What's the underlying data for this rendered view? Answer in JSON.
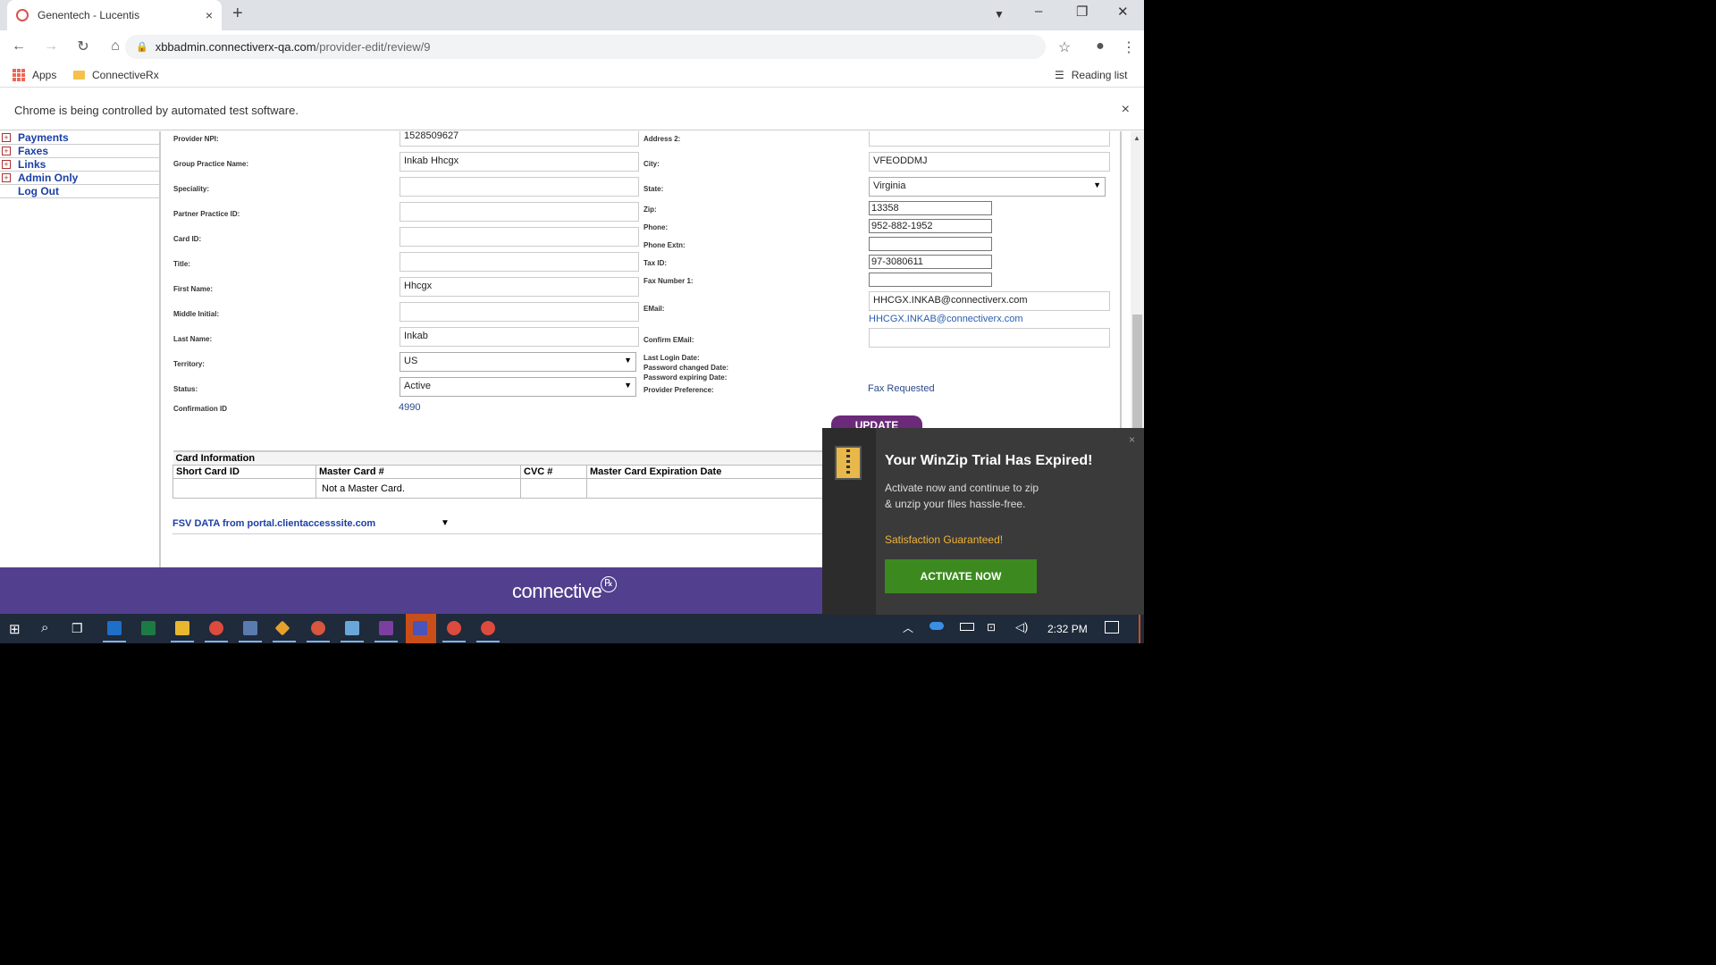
{
  "browser": {
    "tab_title": "Genentech - Lucentis",
    "tab_close": "×",
    "new_tab": "+",
    "url_host": "xbbadmin.connectiverx-qa.com",
    "url_path": "/provider-edit/review/9",
    "bookmarks": [
      {
        "label": "Apps"
      },
      {
        "label": "ConnectiveRx"
      }
    ],
    "reading_list": "Reading list",
    "infobar_text": "Chrome is being controlled by automated test software.",
    "infobar_close": "×"
  },
  "sidebar": {
    "items": [
      {
        "label": "Payments"
      },
      {
        "label": "Faxes"
      },
      {
        "label": "Links"
      },
      {
        "label": "Admin Only"
      }
    ],
    "logout": "Log Out"
  },
  "form": {
    "left": {
      "provider_npi": {
        "label": "Provider NPI:",
        "value": "1528509627"
      },
      "group_practice": {
        "label": "Group Practice Name:",
        "value": "Inkab Hhcgx"
      },
      "speciality": {
        "label": "Speciality:",
        "value": ""
      },
      "partner_practice": {
        "label": "Partner Practice ID:",
        "value": ""
      },
      "card_id": {
        "label": "Card ID:",
        "value": ""
      },
      "title": {
        "label": "Title:",
        "value": ""
      },
      "first_name": {
        "label": "First Name:",
        "value": "Hhcgx"
      },
      "middle_initial": {
        "label": "Middle Initial:",
        "value": ""
      },
      "last_name": {
        "label": "Last Name:",
        "value": "Inkab"
      },
      "territory": {
        "label": "Territory:",
        "value": "US"
      },
      "status": {
        "label": "Status:",
        "value": "Active"
      },
      "confirmation": {
        "label": "Confirmation ID",
        "value": "4990"
      }
    },
    "right": {
      "address2": {
        "label": "Address 2:",
        "value": ""
      },
      "city": {
        "label": "City:",
        "value": "VFEODDMJ"
      },
      "state": {
        "label": "State:",
        "value": "Virginia"
      },
      "zip": {
        "label": "Zip:",
        "value": "13358"
      },
      "phone": {
        "label": "Phone:",
        "value": "952-882-1952"
      },
      "phone_extn": {
        "label": "Phone Extn:",
        "value": ""
      },
      "tax_id": {
        "label": "Tax ID:",
        "value": "97-3080611"
      },
      "fax1": {
        "label": "Fax Number 1:",
        "value": ""
      },
      "email": {
        "label": "EMail:",
        "value": "HHCGX.INKAB@connectiverx.com",
        "link": "HHCGX.INKAB@connectiverx.com"
      },
      "confirm_email": {
        "label": "Confirm EMail:",
        "value": ""
      },
      "last_login": {
        "label": "Last Login Date:"
      },
      "pwd_changed": {
        "label": "Password changed Date:"
      },
      "pwd_expiring": {
        "label": "Password expiring Date:"
      },
      "provider_pref": {
        "label": "Provider Preference:",
        "value": "Fax Requested"
      }
    },
    "update_button": "UPDATE"
  },
  "card_info": {
    "caption": "Card Information",
    "headers": [
      "Short Card ID",
      "Master Card #",
      "CVC #",
      "Master Card Expiration Date"
    ],
    "row": [
      "",
      "Not a Master Card.",
      "",
      ""
    ]
  },
  "fsv": {
    "label": "FSV DATA from portal.clientaccesssite.com"
  },
  "footer": {
    "logo": "connective"
  },
  "winzip": {
    "title": "Your WinZip Trial Has Expired!",
    "body": "Activate now and continue to zip & unzip your files hassle-free.",
    "satisfaction": "Satisfaction Guaranteed!",
    "button": "ACTIVATE NOW",
    "close": "×"
  },
  "taskbar": {
    "clock": "2:32 PM"
  },
  "colors": {
    "footer": "#523f8e",
    "update": "#6b2a7a",
    "activate": "#3c8a1f",
    "taskbar": "#1f2a3a"
  }
}
